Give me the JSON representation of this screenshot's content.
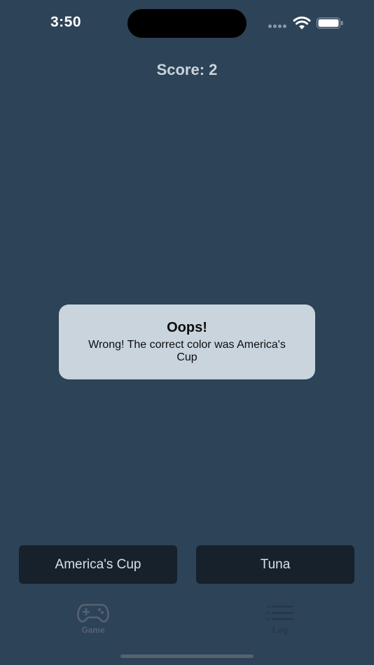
{
  "status_bar": {
    "time": "3:50"
  },
  "game": {
    "score_text": "Score: 2"
  },
  "alert": {
    "title": "Oops!",
    "message": "Wrong! The correct color was America's Cup"
  },
  "answers": {
    "left_label": "America's Cup",
    "right_label": "Tuna"
  },
  "tab_bar": {
    "items": [
      {
        "label": "Game",
        "icon": "gamecontroller-icon"
      },
      {
        "label": "Log",
        "icon": "list-icon"
      }
    ]
  },
  "colors": {
    "background": "#2d4357",
    "alert_background": "#c9d4dd",
    "button_background": "#16212c"
  }
}
